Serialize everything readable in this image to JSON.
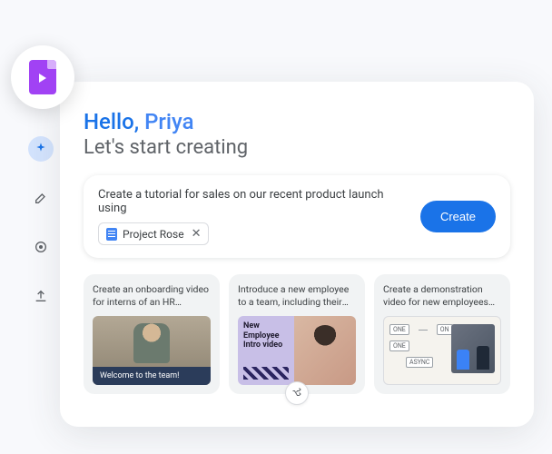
{
  "greeting": {
    "hello": "Hello,",
    "name": "Priya",
    "subtitle": "Let's start creating"
  },
  "prompt": {
    "text": "Create a tutorial for sales on our recent product launch using",
    "chip_label": "Project Rose",
    "create_label": "Create"
  },
  "suggestions": [
    {
      "title": "Create an onboarding video for interns of an HR company",
      "banner": "Welcome to the team!"
    },
    {
      "title": "Introduce a new employee to a team, including their past roles...",
      "thumb_text": "New Employee Intro video"
    },
    {
      "title": "Create a demonstration video for new employees that details...",
      "nodes": {
        "one1": "ONE",
        "on": "ON",
        "one2": "ONE",
        "async": "ASYNC"
      }
    }
  ]
}
